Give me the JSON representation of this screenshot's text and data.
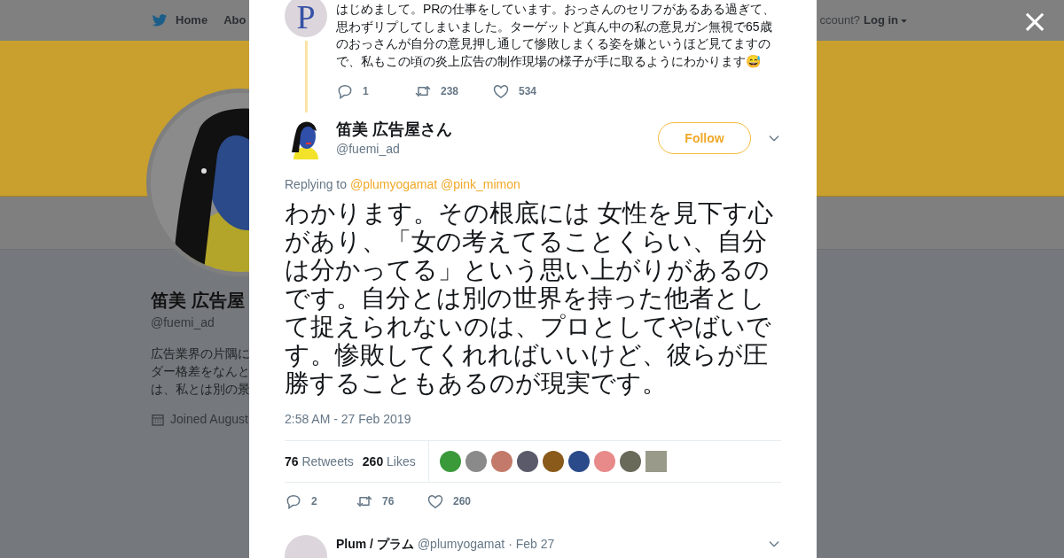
{
  "nav": {
    "home": "Home",
    "about": "Abo",
    "account_prompt": "ccount?",
    "login": "Log in"
  },
  "profile": {
    "name": "笛美 広告屋",
    "handle": "@fuemi_ad",
    "bio_lines": [
      "広告業界の片隅に",
      "ダー格差をなんと",
      "は、私とは別の景"
    ],
    "joined": "Joined August"
  },
  "modal": {
    "parent_tweet": {
      "text": "はじめまして。PRの仕事をしています。おっさんのセリフがあるある過ぎて、思わずリプしてしまいました。ターゲットど真ん中の私の意見ガン無視で65歳のおっさんが自分の意見押し通して惨敗しまくる姿を嫌というほど見てますので、私もこの頃の炎上広告の制作現場の様子が手に取るようにわかります😅",
      "avatar_letter": "P",
      "replies": "1",
      "retweets": "238",
      "likes": "534"
    },
    "tweet": {
      "name": "笛美 広告屋さん",
      "handle": "@fuemi_ad",
      "follow": "Follow",
      "replying_label": "Replying to",
      "replying_to": [
        "@plumyogamat",
        "@pink_mimon"
      ],
      "text": "わかります。その根底には 女性を見下す心があり、「女の考えてることくらい、自分は分かってる」という思い上がりがあるのです。自分とは別の世界を持った他者として捉えられないのは、プロとしてやばいです。惨敗してくれればいいけど、彼らが圧勝することもあるのが現実です。",
      "time": "2:58 AM - 27 Feb 2019",
      "retweet_count": "76",
      "retweet_label": "Retweets",
      "like_count": "260",
      "like_label": "Likes",
      "replies": "2",
      "retweets": "76",
      "likes": "260"
    },
    "next_tweet": {
      "name": "Plum / プラム",
      "handle": "@plumyogamat",
      "date": "· Feb 27"
    },
    "close": "×"
  }
}
